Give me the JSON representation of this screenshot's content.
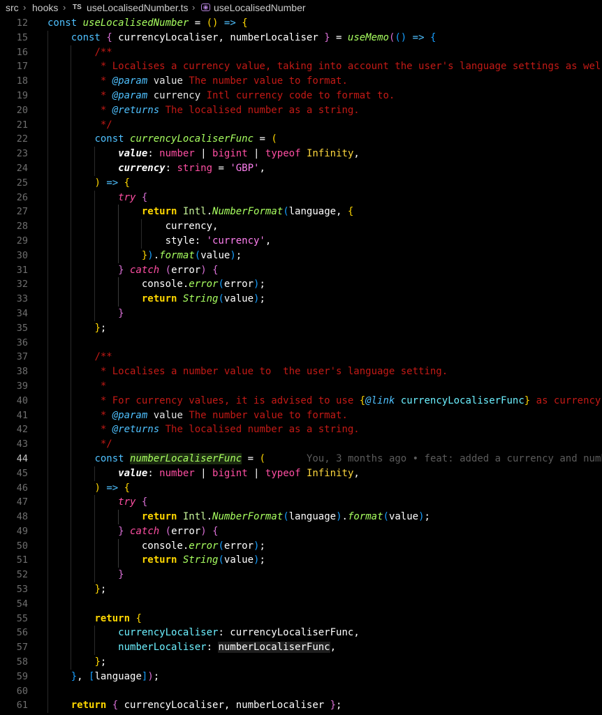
{
  "breadcrumb": {
    "items": [
      "src",
      "hooks",
      "useLocalisedNumber.ts",
      "useLocalisedNumber"
    ],
    "ts_badge": "TS"
  },
  "editor": {
    "active_line": 44,
    "blame_annotation": "You, 3 months ago • feat: added a currency and numb",
    "lines": [
      {
        "n": 12,
        "text": "const useLocalisedNumber = () => {"
      },
      {
        "n": 15,
        "text": "    const { currencyLocaliser, numberLocaliser } = useMemo(() => {"
      },
      {
        "n": 16,
        "text": "        /**"
      },
      {
        "n": 17,
        "text": "         * Localises a currency value, taking into account the user's language settings as wel"
      },
      {
        "n": 18,
        "text": "         * @param value The number value to format."
      },
      {
        "n": 19,
        "text": "         * @param currency Intl currency code to format to."
      },
      {
        "n": 20,
        "text": "         * @returns The localised number as a string."
      },
      {
        "n": 21,
        "text": "         */"
      },
      {
        "n": 22,
        "text": "        const currencyLocaliserFunc = ("
      },
      {
        "n": 23,
        "text": "            value: number | bigint | typeof Infinity,"
      },
      {
        "n": 24,
        "text": "            currency: string = 'GBP',"
      },
      {
        "n": 25,
        "text": "        ) => {"
      },
      {
        "n": 26,
        "text": "            try {"
      },
      {
        "n": 27,
        "text": "                return Intl.NumberFormat(language, {"
      },
      {
        "n": 28,
        "text": "                    currency,"
      },
      {
        "n": 29,
        "text": "                    style: 'currency',"
      },
      {
        "n": 30,
        "text": "                }).format(value);"
      },
      {
        "n": 31,
        "text": "            } catch (error) {"
      },
      {
        "n": 32,
        "text": "                console.error(error);"
      },
      {
        "n": 33,
        "text": "                return String(value);"
      },
      {
        "n": 34,
        "text": "            }"
      },
      {
        "n": 35,
        "text": "        };"
      },
      {
        "n": 36,
        "text": ""
      },
      {
        "n": 37,
        "text": "        /**"
      },
      {
        "n": 38,
        "text": "         * Localises a number value to  the user's language setting."
      },
      {
        "n": 39,
        "text": "         *"
      },
      {
        "n": 40,
        "text": "         * For currency values, it is advised to use {@link currencyLocaliserFunc} as currency"
      },
      {
        "n": 41,
        "text": "         * @param value The number value to format."
      },
      {
        "n": 42,
        "text": "         * @returns The localised number as a string."
      },
      {
        "n": 43,
        "text": "         */"
      },
      {
        "n": 44,
        "text": "        const numberLocaliserFunc = (       You, 3 months ago • feat: added a currency and numb"
      },
      {
        "n": 45,
        "text": "            value: number | bigint | typeof Infinity,"
      },
      {
        "n": 46,
        "text": "        ) => {"
      },
      {
        "n": 47,
        "text": "            try {"
      },
      {
        "n": 48,
        "text": "                return Intl.NumberFormat(language).format(value);"
      },
      {
        "n": 49,
        "text": "            } catch (error) {"
      },
      {
        "n": 50,
        "text": "                console.error(error);"
      },
      {
        "n": 51,
        "text": "                return String(value);"
      },
      {
        "n": 52,
        "text": "            }"
      },
      {
        "n": 53,
        "text": "        };"
      },
      {
        "n": 54,
        "text": ""
      },
      {
        "n": 55,
        "text": "        return {"
      },
      {
        "n": 56,
        "text": "            currencyLocaliser: currencyLocaliserFunc,"
      },
      {
        "n": 57,
        "text": "            numberLocaliser: numberLocaliserFunc,"
      },
      {
        "n": 58,
        "text": "        };"
      },
      {
        "n": 59,
        "text": "    }, [language]);"
      },
      {
        "n": 60,
        "text": ""
      },
      {
        "n": 61,
        "text": "    return { currencyLocaliser, numberLocaliser };"
      }
    ]
  },
  "colors": {
    "background": "#000000",
    "keyword": "#4fc1ff",
    "function": "#a8ff60",
    "comment": "#c41a16",
    "string": "#ff7ff0",
    "control": "#ff4fa3",
    "bracket_1": "#ffd700",
    "bracket_2": "#da70d6",
    "bracket_3": "#179fff"
  }
}
